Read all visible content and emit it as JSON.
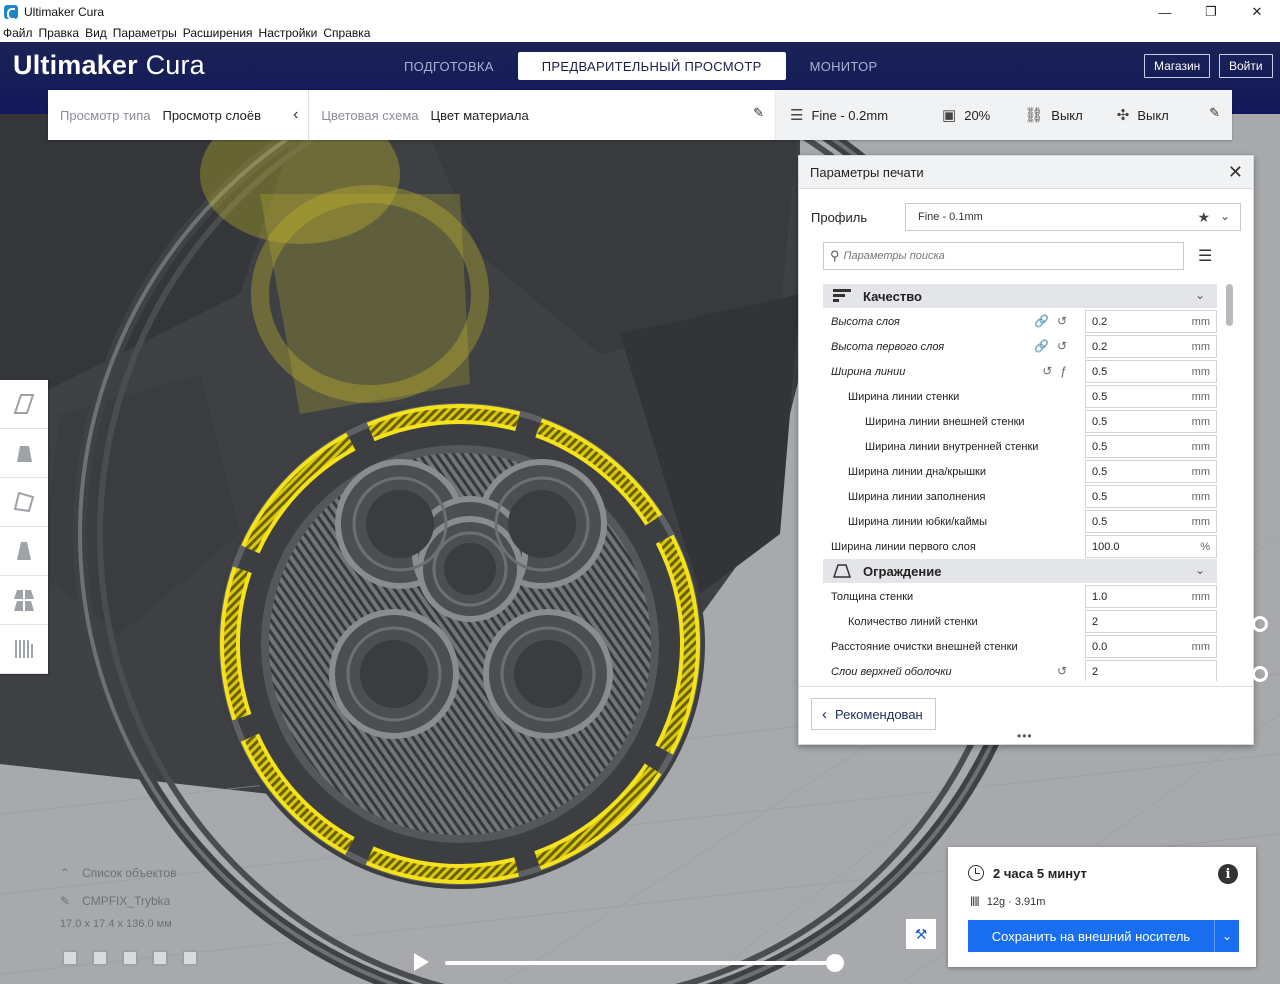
{
  "window": {
    "title": "Ultimaker Cura",
    "minimize": "—",
    "maximize": "❐",
    "close": "✕"
  },
  "menu": [
    "Файл",
    "Правка",
    "Вид",
    "Параметры",
    "Расширения",
    "Настройки",
    "Справка"
  ],
  "header": {
    "logo_bold": "Ultimaker",
    "logo_light": "Cura",
    "tabs": [
      "ПОДГОТОВКА",
      "ПРЕДВАРИТЕЛЬНЫЙ ПРОСМОТР",
      "МОНИТОР"
    ],
    "active_tab": 1,
    "store_label": "Магазин",
    "login_label": "Войти"
  },
  "view_toolbar": {
    "view_type_label": "Просмотр типа",
    "view_type_value": "Просмотр слоёв",
    "color_scheme_label": "Цветовая схема",
    "color_scheme_value": "Цвет материала"
  },
  "print_toolbar": {
    "profile": "Fine - 0.2mm",
    "infill": "20%",
    "support": "Выкл",
    "adhesion": "Выкл"
  },
  "settings_panel": {
    "title": "Параметры печати",
    "profile_label": "Профиль",
    "profile_value": "Fine - 0.1mm",
    "search_placeholder": "Параметры поиска",
    "categories": [
      {
        "label": "Качество",
        "rows": [
          {
            "name": "Высота слоя",
            "value": "0.2",
            "unit": "mm",
            "indent": 0,
            "italic": true,
            "icons": [
              "link",
              "reset"
            ]
          },
          {
            "name": "Высота первого слоя",
            "value": "0.2",
            "unit": "mm",
            "indent": 0,
            "italic": true,
            "icons": [
              "link",
              "reset"
            ]
          },
          {
            "name": "Ширина линии",
            "value": "0.5",
            "unit": "mm",
            "indent": 0,
            "italic": true,
            "icons": [
              "reset",
              "function"
            ]
          },
          {
            "name": "Ширина линии стенки",
            "value": "0.5",
            "unit": "mm",
            "indent": 1,
            "italic": false,
            "icons": []
          },
          {
            "name": "Ширина линии внешней стенки",
            "value": "0.5",
            "unit": "mm",
            "indent": 2,
            "italic": false,
            "icons": []
          },
          {
            "name": "Ширина линии внутренней стенки",
            "value": "0.5",
            "unit": "mm",
            "indent": 2,
            "italic": false,
            "icons": []
          },
          {
            "name": "Ширина линии дна/крышки",
            "value": "0.5",
            "unit": "mm",
            "indent": 1,
            "italic": false,
            "icons": []
          },
          {
            "name": "Ширина линии заполнения",
            "value": "0.5",
            "unit": "mm",
            "indent": 1,
            "italic": false,
            "icons": []
          },
          {
            "name": "Ширина линии юбки/каймы",
            "value": "0.5",
            "unit": "mm",
            "indent": 1,
            "italic": false,
            "icons": []
          },
          {
            "name": "Ширина линии первого слоя",
            "value": "100.0",
            "unit": "%",
            "indent": 0,
            "italic": false,
            "icons": []
          }
        ]
      },
      {
        "label": "Ограждение",
        "rows": [
          {
            "name": "Толщина стенки",
            "value": "1.0",
            "unit": "mm",
            "indent": 0,
            "italic": false,
            "icons": []
          },
          {
            "name": "Количество линий стенки",
            "value": "2",
            "unit": "",
            "indent": 1,
            "italic": false,
            "icons": []
          },
          {
            "name": "Расстояние очистки внешней стенки",
            "value": "0.0",
            "unit": "mm",
            "indent": 0,
            "italic": false,
            "icons": []
          },
          {
            "name": "Слои верхней оболочки",
            "value": "2",
            "unit": "",
            "indent": 0,
            "italic": true,
            "icons": [
              "reset"
            ]
          }
        ]
      }
    ],
    "recommended_label": "Рекомендован",
    "grip": "•••"
  },
  "object_list": {
    "header": "Список объектов",
    "object_name": "CMPFIX_Trybka",
    "dimensions": "17.0 x 17.4 x 136.0 мм"
  },
  "layer_slider": {
    "progress": 1.0
  },
  "action_panel": {
    "print_time": "2 часа 5 минут",
    "material": "12g · 3.91m",
    "save_label": "Сохранить на внешний носитель"
  },
  "colors": {
    "header_bg": "#12185a",
    "accent_blue": "#196ef0",
    "extrusion_yellow": "#f4e21c",
    "extrusion_grey": "#4c4e52"
  }
}
